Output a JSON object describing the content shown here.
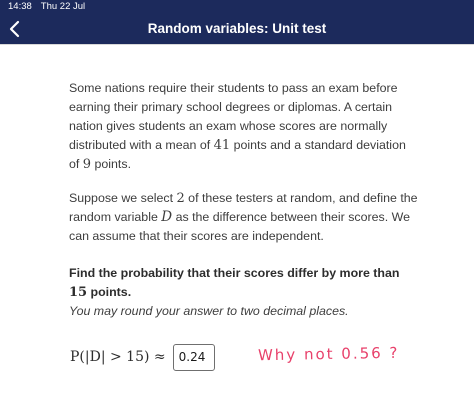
{
  "status_bar": {
    "time": "14:38",
    "date": "Thu 22 Jul"
  },
  "nav": {
    "title": "Random variables: Unit test",
    "back_icon": "chevron-left-icon"
  },
  "problem": {
    "p1_before_mean": "Some nations require their students to pass an exam before earning their primary school degrees or diplomas. A certain nation gives students an exam whose scores are normally distributed with a mean of ",
    "mean": "41",
    "p1_between": " points and a standard deviation of ",
    "sd": "9",
    "p1_after": " points.",
    "p2_before_n": "Suppose we select ",
    "n": "2",
    "p2_middle": " of these testers at random, and define the random variable ",
    "variable": "D",
    "p2_after": " as the difference between their scores. We can assume that their scores are independent.",
    "question_before": "Find the probability that their scores differ by more than ",
    "threshold": "15",
    "question_after": " points.",
    "hint": "You may round your answer to two decimal places."
  },
  "answer": {
    "expression": "P(|D| > 15) ≈",
    "value": "0.24"
  },
  "annotation": {
    "handwritten_text": "Why not 0.56 ?"
  },
  "colors": {
    "nav_background": "#1c2a5c",
    "annotation": "#e8416b"
  }
}
